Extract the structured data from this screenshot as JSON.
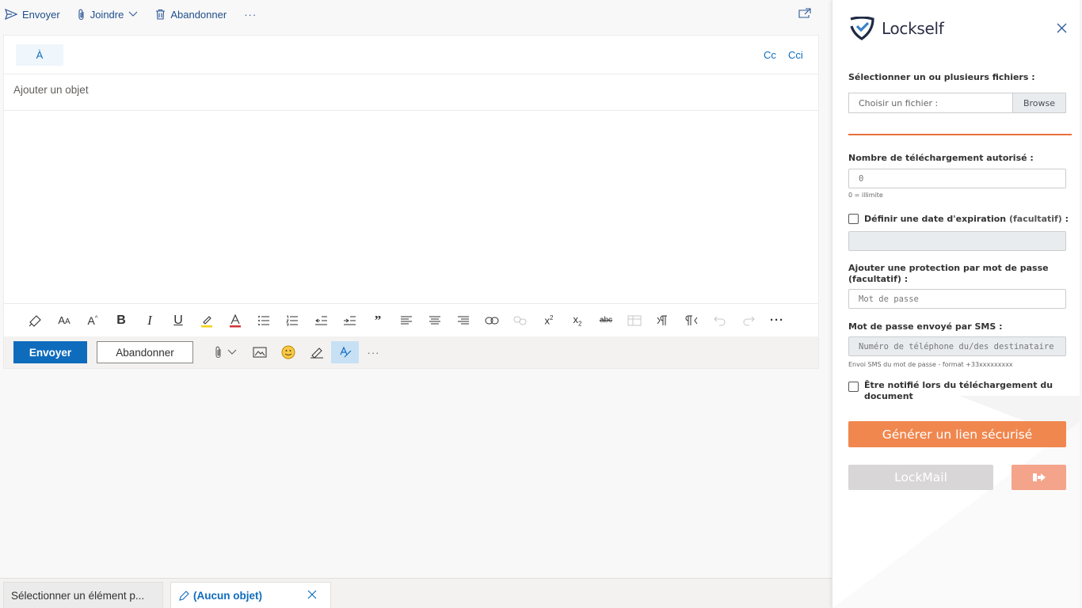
{
  "toolbar": {
    "send_label": "Envoyer",
    "attach_label": "Joindre",
    "discard_label": "Abandonner",
    "more_label": "···"
  },
  "compose": {
    "to_label": "À",
    "cc_label": "Cc",
    "bcc_label": "Cci",
    "subject_placeholder": "Ajouter un objet",
    "send_label": "Envoyer",
    "discard_label": "Abandonner"
  },
  "format_toolbar": {
    "items": [
      "format-painter-icon",
      "font-size-icon",
      "grow-font-icon",
      "bold-icon",
      "italic-icon",
      "underline-icon",
      "highlight-icon",
      "font-color-icon",
      "bullets-icon",
      "numbering-icon",
      "decrease-indent-icon",
      "increase-indent-icon",
      "quote-icon",
      "align-left-icon",
      "align-center-icon",
      "align-right-icon",
      "link-icon",
      "unlink-icon",
      "superscript-icon",
      "subscript-icon",
      "strikethrough-icon",
      "insert-table-icon",
      "ltr-icon",
      "rtl-icon",
      "undo-icon",
      "redo-icon",
      "more-icon"
    ]
  },
  "bottom_tabs": {
    "tab1": "Sélectionner un élément p...",
    "tab2": "(Aucun objet)"
  },
  "lockself": {
    "brand": "Lockself",
    "select_files_label": "Sélectionner un ou plusieurs fichiers :",
    "file_placeholder": "Choisir un fichier :",
    "browse_label": "Browse",
    "downloads_label": "Nombre de téléchargement autorisé :",
    "downloads_value": "0",
    "downloads_hint": "0 = illimite",
    "expiration_label": "Définir une date d'expiration",
    "expiration_optional": "(facultatif)",
    "expiration_colon": " :",
    "password_label": "Ajouter une protection par mot de passe",
    "password_optional": "(facultatif) :",
    "password_placeholder": "Mot de passe",
    "sms_label": "Mot de passe envoyé par SMS :",
    "sms_placeholder": "Numéro de téléphone du/des destinataire",
    "sms_hint": "Envoi SMS du mot de passe - format +33xxxxxxxxx",
    "notify_label_1": "Être notifié lors du téléchargement du",
    "notify_label_2": "document",
    "generate_label": "Générer un lien sécurisé",
    "lockmail_label": "LockMail"
  },
  "colors": {
    "accent_blue": "#0f6cbd",
    "lockself_orange": "#f0874f"
  }
}
